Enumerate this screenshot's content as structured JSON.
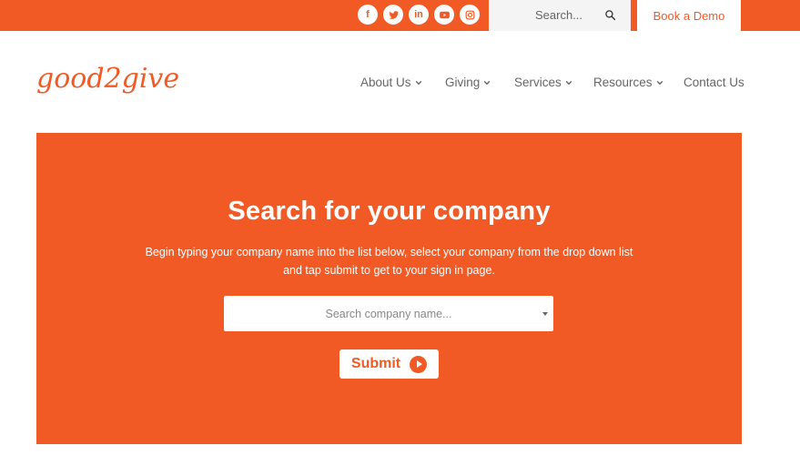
{
  "topbar": {
    "social": [
      {
        "icon": "facebook-icon",
        "glyph": "f"
      },
      {
        "icon": "twitter-icon",
        "glyph": ""
      },
      {
        "icon": "linkedin-icon",
        "glyph": "in"
      },
      {
        "icon": "youtube-icon",
        "glyph": ""
      },
      {
        "icon": "instagram-icon",
        "glyph": ""
      }
    ],
    "search_placeholder": "Search...",
    "demo_label": "Book a Demo"
  },
  "logo": {
    "text": "good2give"
  },
  "nav": {
    "items": [
      {
        "label": "About Us",
        "has_dropdown": true
      },
      {
        "label": "Giving",
        "has_dropdown": true
      },
      {
        "label": "Services",
        "has_dropdown": true
      },
      {
        "label": "Resources",
        "has_dropdown": true
      },
      {
        "label": "Contact Us",
        "has_dropdown": false
      }
    ]
  },
  "hero": {
    "title": "Search for your company",
    "description": "Begin typing your company name into the list below, select your company from the drop down list and tap submit to get to your sign in page.",
    "select_placeholder": "Search company name...",
    "submit_label": "Submit"
  },
  "colors": {
    "brand": "#f15a24",
    "text_grey": "#666666",
    "white": "#ffffff"
  }
}
